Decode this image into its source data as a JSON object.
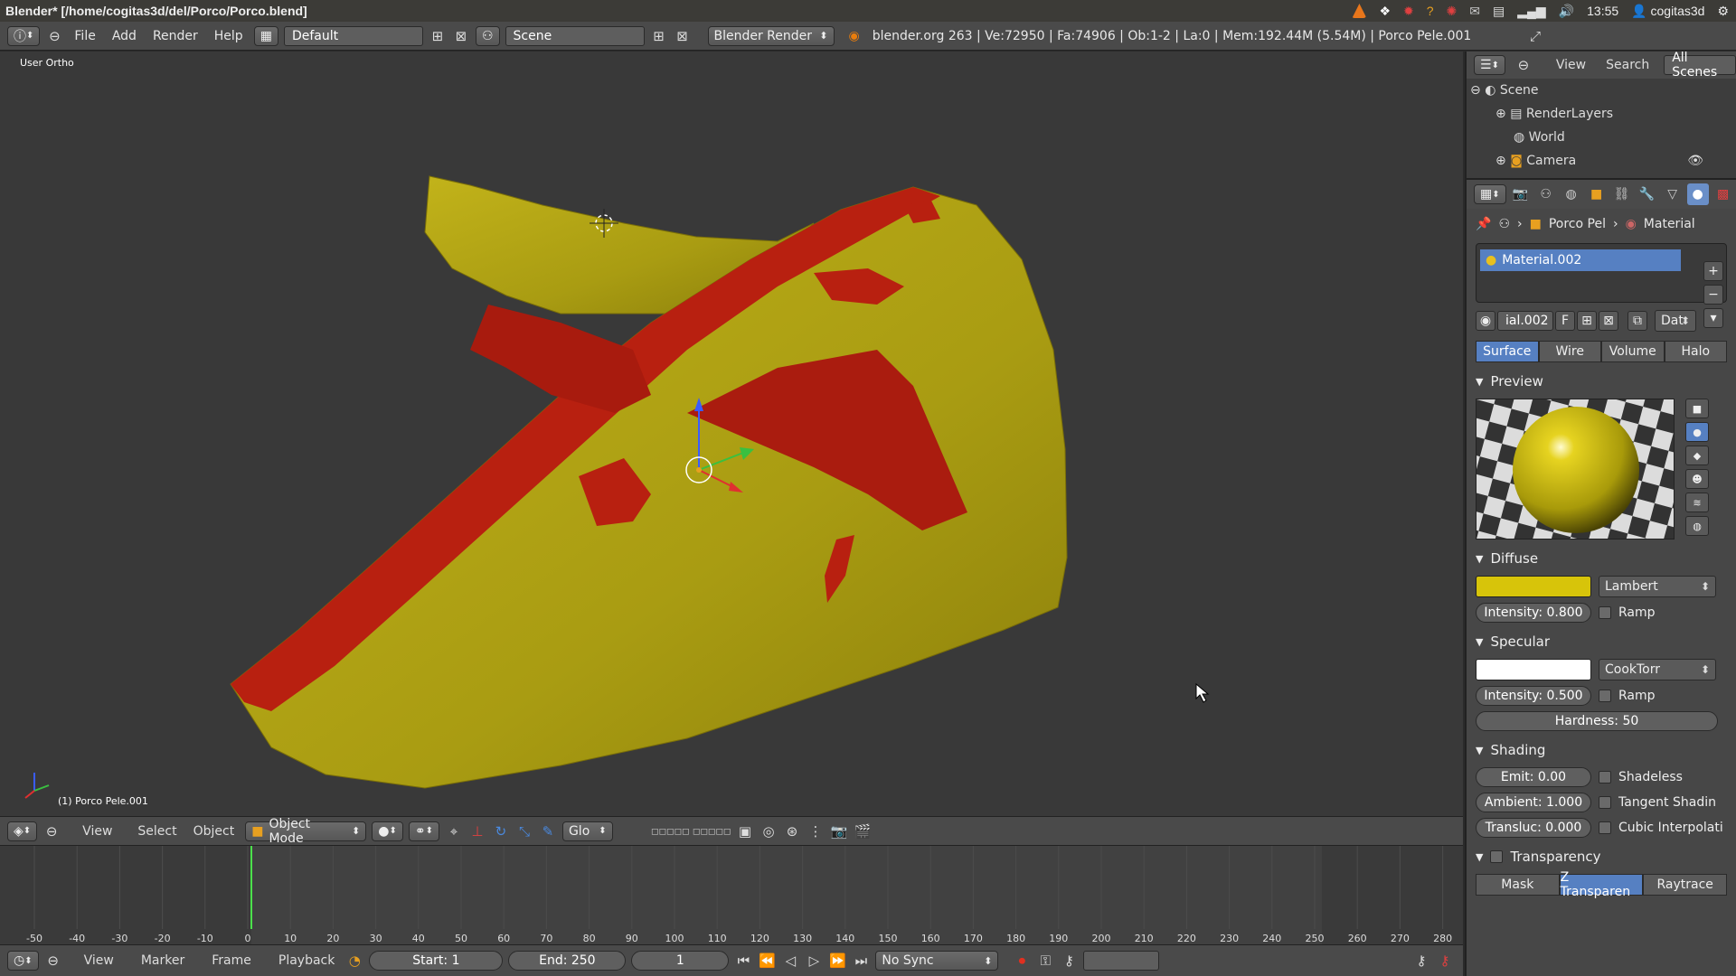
{
  "window": {
    "title": "Blender* [/home/cogitas3d/del/Porco/Porco.blend]",
    "clock": "13:55",
    "user": "cogitas3d"
  },
  "infobar": {
    "menus": [
      "File",
      "Add",
      "Render",
      "Help"
    ],
    "layout": "Default",
    "scene": "Scene",
    "engine": "Blender Render",
    "stats": "blender.org 263 | Ve:72950 | Fa:74906 | Ob:1-2 | La:0 | Mem:192.44M (5.54M) | Porco Pele.001"
  },
  "viewport": {
    "view_label": "User Ortho",
    "object_label": "(1) Porco Pele.001",
    "colors": {
      "mesh_yellow": "#b3a613",
      "mesh_red": "#b82010",
      "background": "#393939"
    }
  },
  "toolbar3d": {
    "menus": [
      "View",
      "Select",
      "Object"
    ],
    "mode": "Object Mode",
    "orientation": "Glo"
  },
  "timeline": {
    "ticks": [
      "-50",
      "-40",
      "-30",
      "-20",
      "-10",
      "0",
      "10",
      "20",
      "30",
      "40",
      "50",
      "60",
      "70",
      "80",
      "90",
      "100",
      "110",
      "120",
      "130",
      "140",
      "150",
      "160",
      "170",
      "180",
      "190",
      "200",
      "210",
      "220",
      "230",
      "240",
      "250",
      "260",
      "270",
      "280"
    ],
    "menus": [
      "View",
      "Marker",
      "Frame",
      "Playback"
    ],
    "start": "Start: 1",
    "end": "End: 250",
    "current": "1",
    "sync": "No Sync"
  },
  "outliner": {
    "head_items": [
      "View",
      "Search"
    ],
    "scope": "All Scenes",
    "items": [
      "Scene",
      "RenderLayers",
      "World",
      "Camera"
    ]
  },
  "properties": {
    "crumb_object": "Porco Pel",
    "crumb_material": "Material",
    "material_slot": "Material.002",
    "datablock_name": "ial.002",
    "datablock_f": "F",
    "datablock_scope": "Dat",
    "tabs": [
      "Surface",
      "Wire",
      "Volume",
      "Halo"
    ],
    "preview_title": "Preview",
    "diffuse": {
      "title": "Diffuse",
      "color": "#d7c40a",
      "shader": "Lambert",
      "intensity": "Intensity: 0.800",
      "ramp": "Ramp"
    },
    "specular": {
      "title": "Specular",
      "color": "#ffffff",
      "shader": "CookTorr",
      "intensity": "Intensity: 0.500",
      "ramp": "Ramp",
      "hardness": "Hardness: 50"
    },
    "shading": {
      "title": "Shading",
      "emit": "Emit: 0.00",
      "ambient": "Ambient: 1.000",
      "transluc": "Transluc: 0.000",
      "shadeless": "Shadeless",
      "tangent": "Tangent Shadin",
      "cubic": "Cubic Interpolati"
    },
    "transparency": {
      "title": "Transparency",
      "modes": [
        "Mask",
        "Z Transparen",
        "Raytrace"
      ]
    }
  }
}
